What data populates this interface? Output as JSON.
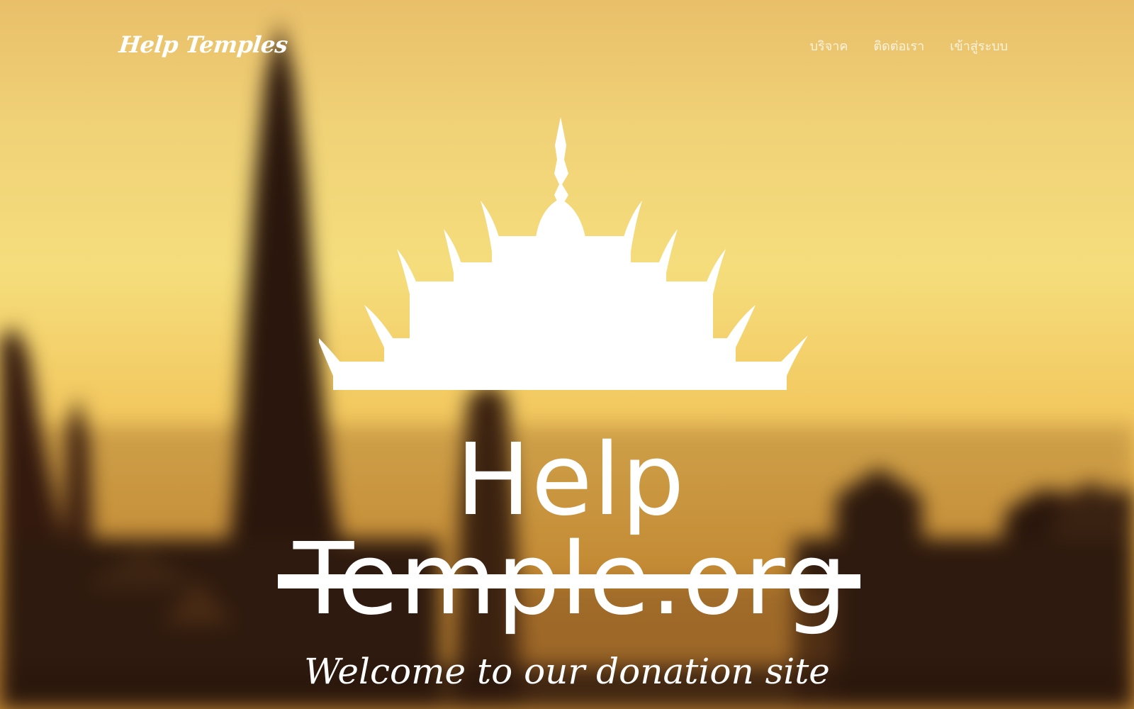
{
  "navbar": {
    "brand": "Help Temples",
    "links": [
      {
        "label": "บริจาค"
      },
      {
        "label": "ติดต่อเรา"
      },
      {
        "label": "เข้าสู่ระบบ"
      }
    ]
  },
  "hero": {
    "logo_text": "Help Temple.org",
    "welcome": "Welcome to our donation site"
  },
  "colors": {
    "sky_top": "#e9bf6a",
    "sky_mid": "#f5dd7c",
    "sky_low": "#e4a63e",
    "silhouette": "#2a160c",
    "text": "#ffffff"
  }
}
